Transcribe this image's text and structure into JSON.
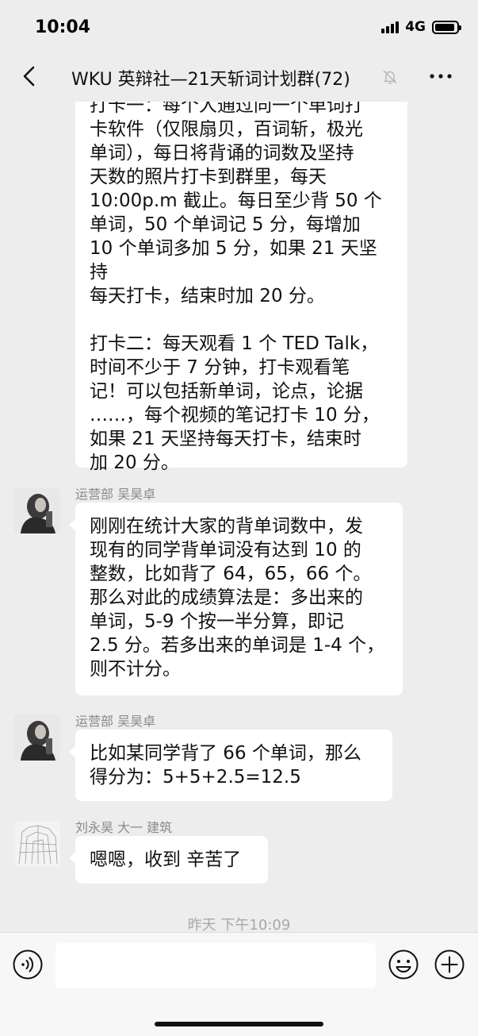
{
  "status_bar": {
    "time": "10:04",
    "network": "4G"
  },
  "nav": {
    "title": "WKU 英辩社—21天斩词计划群(72)",
    "back_icon": "chevron-left-icon",
    "mute_icon": "bell-off-icon",
    "more_icon": "ellipsis-icon"
  },
  "messages": [
    {
      "sender": "",
      "paragraphs": [
        "打卡一：每个人通过同一个单词打\n卡软件（仅限扇贝，百词斩，极光\n单词），每日将背诵的词数及坚持\n天数的照片打卡到群里，每天\n10:00p.m 截止。每日至少背 50 个\n单词，50 个单词记 5 分，每增加\n10 个单词多加 5 分，如果 21 天坚持\n每天打卡，结束时加 20 分。",
        "打卡二：每天观看 1 个 TED Talk，\n时间不少于 7 分钟，打卡观看笔\n记！可以包括新单词，论点，论据\n……，每个视频的笔记打卡 10 分，\n如果 21 天坚持每天打卡，结束时\n加 20 分。"
      ]
    },
    {
      "sender": "运营部 吴昊卓",
      "paragraphs": [
        "刚刚在统计大家的背单词数中，发\n现有的同学背单词没有达到 10 的\n整数，比如背了 64，65，66 个。\n那么对此的成绩算法是：多出来的\n单词，5-9 个按一半分算，即记\n2.5 分。若多出来的单词是 1-4 个，\n则不计分。"
      ]
    },
    {
      "sender": "运营部 吴昊卓",
      "paragraphs": [
        "比如某同学背了 66 个单词，那么\n得分为：5+5+2.5=12.5"
      ]
    },
    {
      "sender": "刘永昊 大一 建筑",
      "paragraphs": [
        "嗯嗯，收到 辛苦了"
      ]
    }
  ],
  "timestamp": "昨天 下午10:09",
  "input_bar": {
    "placeholder": "",
    "voice_icon": "voice-icon",
    "emoji_icon": "emoji-icon",
    "add_icon": "plus-circle-icon"
  },
  "colors": {
    "background": "#ededed",
    "bubble": "#ffffff",
    "sender_text": "#8a8a8a",
    "timestamp_text": "#a8a8a8"
  }
}
